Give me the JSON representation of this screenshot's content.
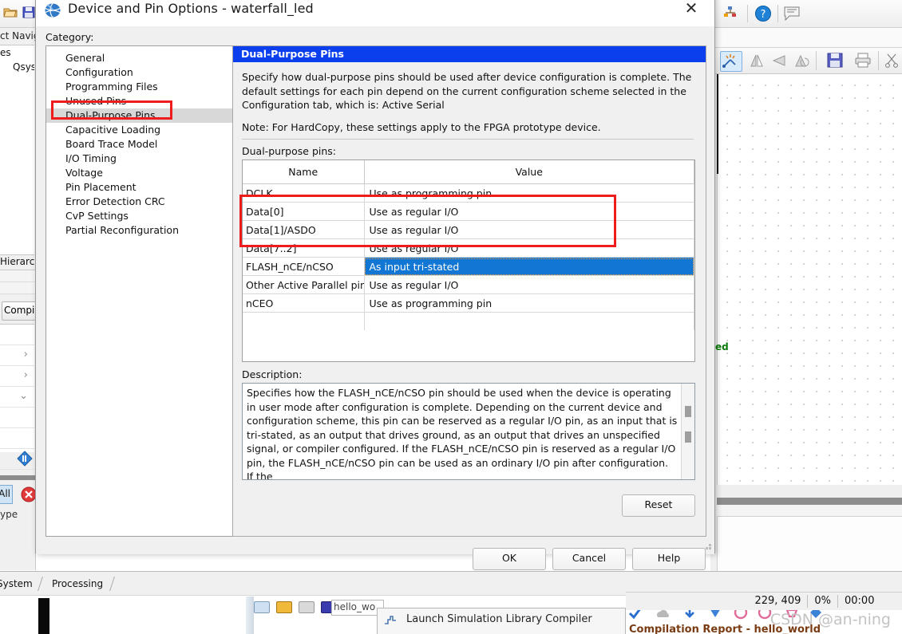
{
  "dialog": {
    "title": "Device and Pin Options - waterfall_led",
    "icon": "quartus-globe-icon",
    "close_label": "✕",
    "category_label": "Category:",
    "categories": [
      {
        "label": "General",
        "selected": false
      },
      {
        "label": "Configuration",
        "selected": false
      },
      {
        "label": "Programming Files",
        "selected": false
      },
      {
        "label": "Unused Pins",
        "selected": false
      },
      {
        "label": "Dual-Purpose Pins",
        "selected": true
      },
      {
        "label": "Capacitive Loading",
        "selected": false
      },
      {
        "label": "Board Trace Model",
        "selected": false
      },
      {
        "label": "I/O Timing",
        "selected": false
      },
      {
        "label": "Voltage",
        "selected": false
      },
      {
        "label": "Pin Placement",
        "selected": false
      },
      {
        "label": "Error Detection CRC",
        "selected": false
      },
      {
        "label": "CvP Settings",
        "selected": false
      },
      {
        "label": "Partial Reconfiguration",
        "selected": false
      }
    ],
    "panel": {
      "header": "Dual-Purpose Pins",
      "paragraph1": "Specify how dual-purpose pins should be used after device configuration is complete. The default settings for each pin depend on the current configuration scheme selected in the Configuration tab, which is:  Active Serial",
      "paragraph2": "Note: For HardCopy, these settings apply to the FPGA prototype device.",
      "grid_label": "Dual-purpose pins:",
      "columns": [
        "Name",
        "Value"
      ],
      "rows": [
        {
          "name": "DCLK",
          "value": "Use as programming pin",
          "selected": false
        },
        {
          "name": "Data[0]",
          "value": "Use as regular I/O",
          "selected": false
        },
        {
          "name": "Data[1]/ASDO",
          "value": "Use as regular I/O",
          "selected": false
        },
        {
          "name": "Data[7..2]",
          "value": "Use as regular I/O",
          "selected": false
        },
        {
          "name": "FLASH_nCE/nCSO",
          "value": "As input tri-stated",
          "selected": true
        },
        {
          "name": "Other Active Parallel pins",
          "value": "Use as regular I/O",
          "selected": false
        },
        {
          "name": "nCEO",
          "value": "Use as programming pin",
          "selected": false
        }
      ],
      "description_label": "Description:",
      "description": "Specifies how the FLASH_nCE/nCSO pin should be used when the device is operating in user mode after configuration is complete. Depending on the current device and configuration scheme, this pin can be reserved as a regular I/O pin, as an input that is tri-stated, as an output that drives ground, as an output that drives an unspecified signal, or compiler configured. If the FLASH_nCE/nCSO pin is reserved as a regular I/O pin, the FLASH_nCE/nCSO pin can be used as an ordinary I/O pin after configuration. If the",
      "reset_label": "Reset"
    },
    "buttons": {
      "ok": "OK",
      "cancel": "Cancel",
      "help": "Help"
    },
    "annotations": {
      "highlight_color": "#ee1c1c",
      "selected_row_color": "#1277d4",
      "panel_header_color": "#0b3fee"
    }
  },
  "background": {
    "left_panel": {
      "nav_title": "ct Naviga",
      "tree_items": [
        "es",
        "Qsys/c"
      ],
      "hierarchy_label": "Hierarch",
      "compile_label": "Compil",
      "chevrons": [
        "›",
        "›",
        "⌄"
      ],
      "all_label": "All",
      "type_label": "ype"
    },
    "bottom_tabs": [
      {
        "label": "System"
      },
      {
        "label": "Processing"
      }
    ],
    "menu_popup": {
      "item": "Launch Simulation Library Compiler",
      "icon": "simulation-icon"
    },
    "file_field": "hello_wo",
    "canvas_label": "ed",
    "compilation_report": "Compilation Report - hello_world",
    "status": {
      "coordinates": "229, 409",
      "percent": "0%",
      "time": "00:00"
    },
    "watermark": "CSDN @an-ning"
  }
}
